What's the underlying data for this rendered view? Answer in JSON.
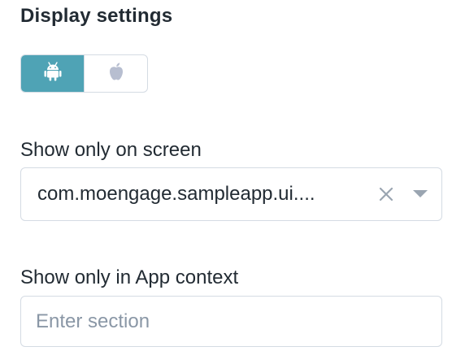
{
  "display_settings": {
    "title": "Display settings"
  },
  "platform_toggle": {
    "options": [
      {
        "icon": "android-icon",
        "active": true
      },
      {
        "icon": "apple-icon",
        "active": false
      }
    ],
    "active_color": "#4fa3b5",
    "inactive_icon_color": "#b7bed0"
  },
  "screen_field": {
    "label": "Show only on screen",
    "value": "com.moengage.sampleapp.ui...."
  },
  "context_field": {
    "label": "Show only in App context",
    "placeholder": "Enter section"
  }
}
